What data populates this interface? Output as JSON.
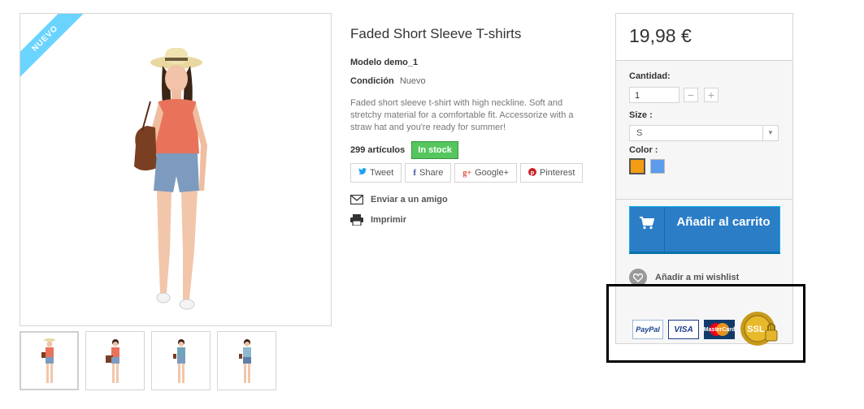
{
  "product": {
    "badge": "NUEVO",
    "title": "Faded Short Sleeve T-shirts",
    "model_label": "Modelo",
    "model_value": "demo_1",
    "condition_label": "Condición",
    "condition_value": "Nuevo",
    "description": "Faded short sleeve t-shirt with high neckline. Soft and stretchy material for a comfortable fit. Accessorize with a straw hat and you're ready for summer!",
    "stock_count": "299 artículos",
    "stock_status": "In stock"
  },
  "social": [
    {
      "label": "Tweet",
      "icon": "twitter-icon",
      "glyph": "🐦"
    },
    {
      "label": "Share",
      "icon": "facebook-icon",
      "glyph": "f"
    },
    {
      "label": "Google+",
      "icon": "googleplus-icon",
      "glyph": "g+"
    },
    {
      "label": "Pinterest",
      "icon": "pinterest-icon",
      "glyph": "P"
    }
  ],
  "actions": {
    "send_friend": "Enviar a un amigo",
    "print": "Imprimir"
  },
  "buybox": {
    "price": "19,98 €",
    "qty_label": "Cantidad:",
    "qty_value": "1",
    "qty_minus": "−",
    "qty_plus": "+",
    "size_label": "Size :",
    "size_value": "S",
    "color_label": "Color :",
    "colors": [
      "#f39c11",
      "#5d9cec"
    ],
    "add_to_cart": "Añadir al carrito",
    "wishlist": "Añadir a mi wishlist"
  },
  "payments": {
    "paypal": "PayPal",
    "visa": "VISA",
    "mastercard": "MasterCard",
    "ssl": "SSL"
  },
  "colors": {
    "accent_blue": "#2b7dc6",
    "in_stock_green": "#55c65e",
    "ribbon": "#6ad4ff",
    "highlight_border": "#000000"
  }
}
